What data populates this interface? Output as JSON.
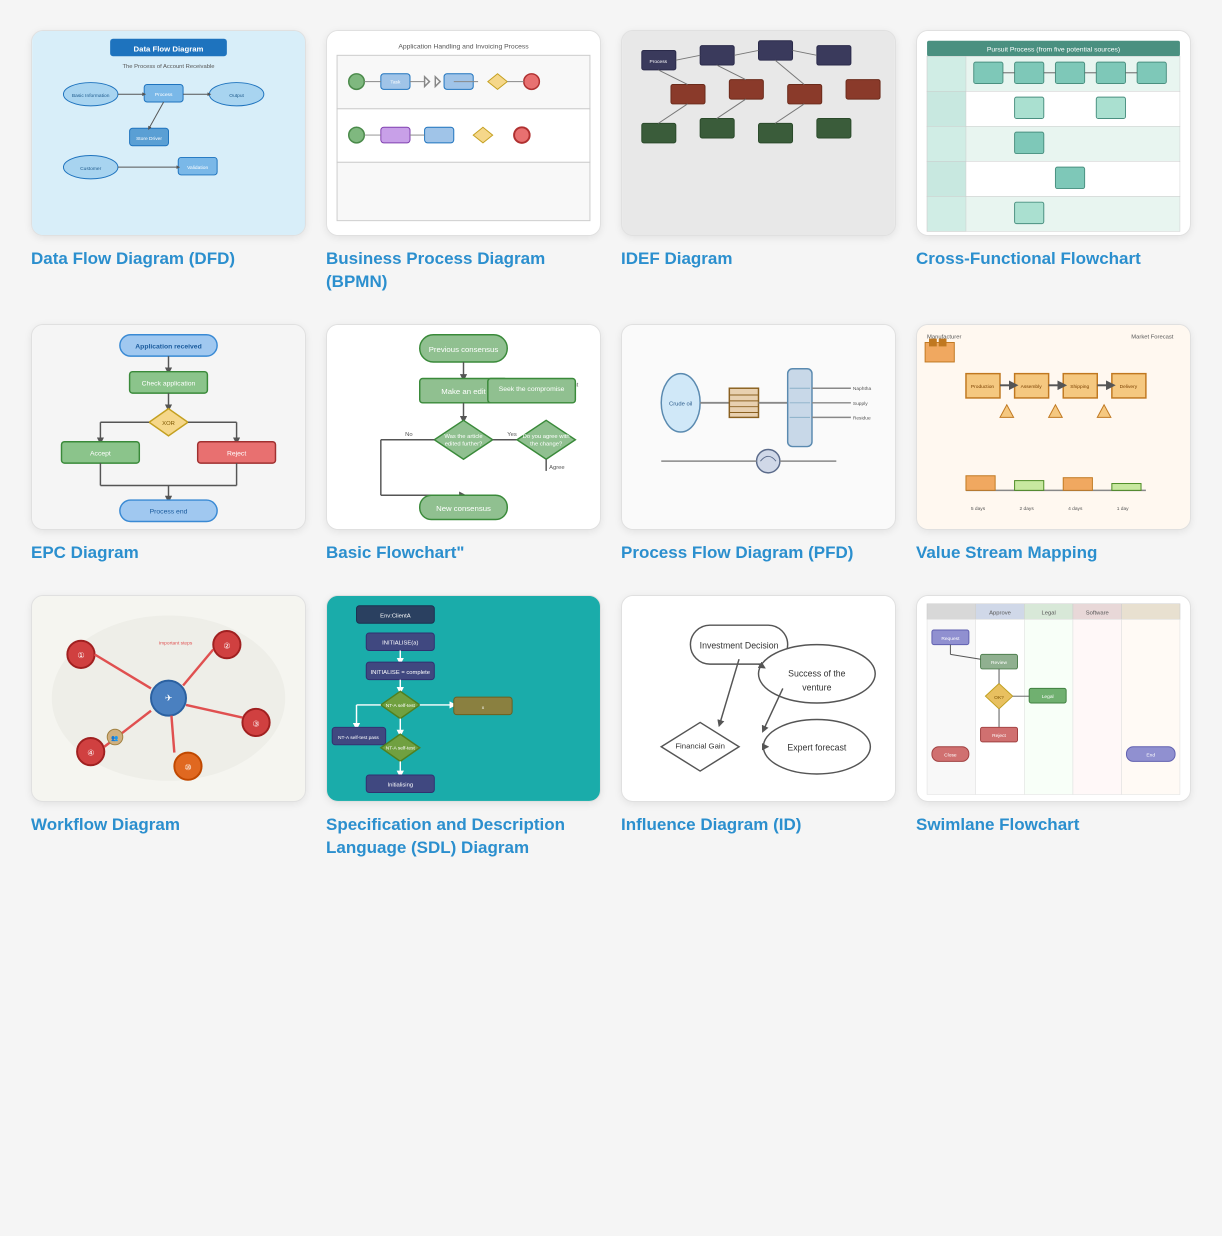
{
  "cards": [
    {
      "id": "dfd",
      "label": "Data Flow Diagram (DFD)",
      "thumb_class": "thumb-dfd",
      "thumb_type": "dfd"
    },
    {
      "id": "bpmn",
      "label": "Business Process Diagram (BPMN)",
      "thumb_class": "thumb-bpmn",
      "thumb_type": "bpmn"
    },
    {
      "id": "idef",
      "label": "IDEF Diagram",
      "thumb_class": "thumb-idef",
      "thumb_type": "idef"
    },
    {
      "id": "cross",
      "label": "Cross-Functional Flowchart",
      "thumb_class": "thumb-cross",
      "thumb_type": "cross"
    },
    {
      "id": "epc",
      "label": "EPC Diagram",
      "thumb_class": "thumb-epc",
      "thumb_type": "epc"
    },
    {
      "id": "basic",
      "label": "Basic Flowchart\"",
      "thumb_class": "thumb-basic",
      "thumb_type": "basic"
    },
    {
      "id": "pfd",
      "label": "Process Flow Diagram (PFD)",
      "thumb_class": "thumb-pfd",
      "thumb_type": "pfd"
    },
    {
      "id": "vsm",
      "label": "Value Stream Mapping",
      "thumb_class": "thumb-vsm",
      "thumb_type": "vsm"
    },
    {
      "id": "workflow",
      "label": "Workflow Diagram",
      "thumb_class": "thumb-workflow",
      "thumb_type": "workflow"
    },
    {
      "id": "sdl",
      "label": "Specification and Description Language (SDL) Diagram",
      "thumb_class": "thumb-sdl",
      "thumb_type": "sdl"
    },
    {
      "id": "influence",
      "label": "Influence Diagram (ID)",
      "thumb_class": "thumb-influence",
      "thumb_type": "influence"
    },
    {
      "id": "swimlane",
      "label": "Swimlane Flowchart",
      "thumb_class": "thumb-swimlane",
      "thumb_type": "swimlane"
    }
  ]
}
